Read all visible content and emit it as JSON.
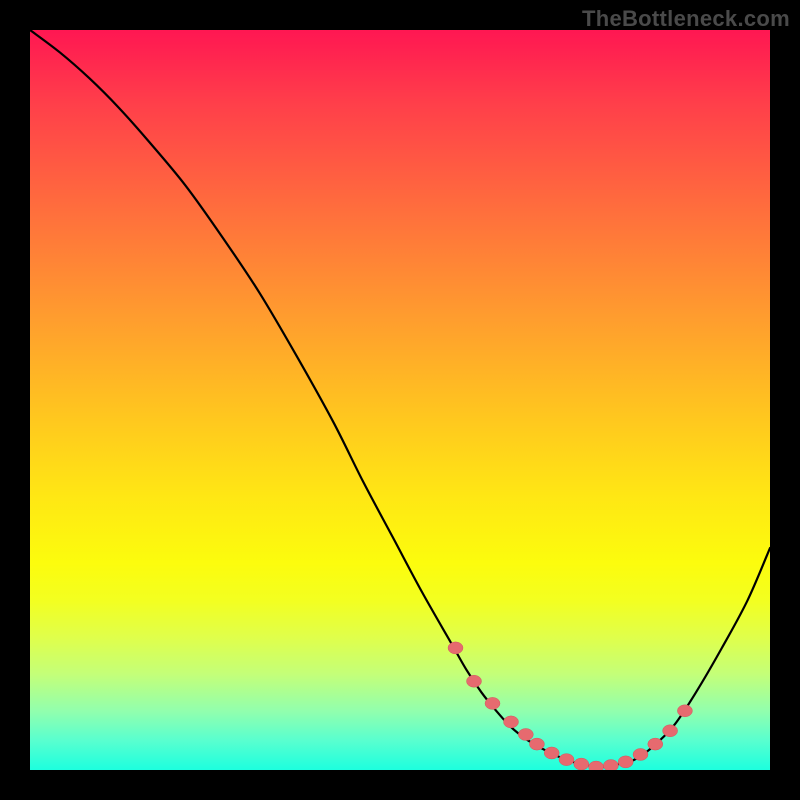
{
  "watermark": "TheBottleneck.com",
  "colors": {
    "frame_bg": "#000000",
    "marker": "#e66a6f",
    "curve": "#000000",
    "gradient": [
      "#ff1752",
      "#ff3f4a",
      "#ff6d3d",
      "#ff9a2f",
      "#ffc61f",
      "#ffe714",
      "#fcfc0d",
      "#f3ff20",
      "#e0ff4a",
      "#c4ff78",
      "#92ffad",
      "#59ffcf",
      "#1dffde"
    ]
  },
  "chart_data": {
    "type": "line",
    "title": "",
    "xlabel": "",
    "ylabel": "",
    "xlim": [
      0,
      100
    ],
    "ylim": [
      0,
      100
    ],
    "series": [
      {
        "name": "curve",
        "x": [
          0,
          4,
          8,
          12,
          16,
          21,
          26,
          31,
          36,
          41,
          45,
          49,
          53,
          57,
          59,
          61,
          63,
          65,
          67,
          69,
          71,
          73,
          75,
          77,
          79,
          81.5,
          84,
          87,
          90,
          93.5,
          97,
          100
        ],
        "y": [
          100,
          97,
          93.5,
          89.5,
          85,
          79,
          72,
          64.5,
          56,
          47,
          39,
          31.5,
          24,
          17,
          13.5,
          10.5,
          8,
          5.8,
          4.2,
          3,
          2,
          1.2,
          0.7,
          0.4,
          0.7,
          1.3,
          3,
          6,
          10.5,
          16.5,
          23,
          30
        ]
      }
    ],
    "markers": {
      "name": "highlighted-points",
      "x": [
        57.5,
        60,
        62.5,
        65,
        67,
        68.5,
        70.5,
        72.5,
        74.5,
        76.5,
        78.5,
        80.5,
        82.5,
        84.5,
        86.5,
        88.5
      ],
      "y": [
        16.5,
        12,
        9,
        6.5,
        4.8,
        3.5,
        2.3,
        1.4,
        0.8,
        0.4,
        0.6,
        1.1,
        2.1,
        3.5,
        5.3,
        8
      ]
    }
  }
}
